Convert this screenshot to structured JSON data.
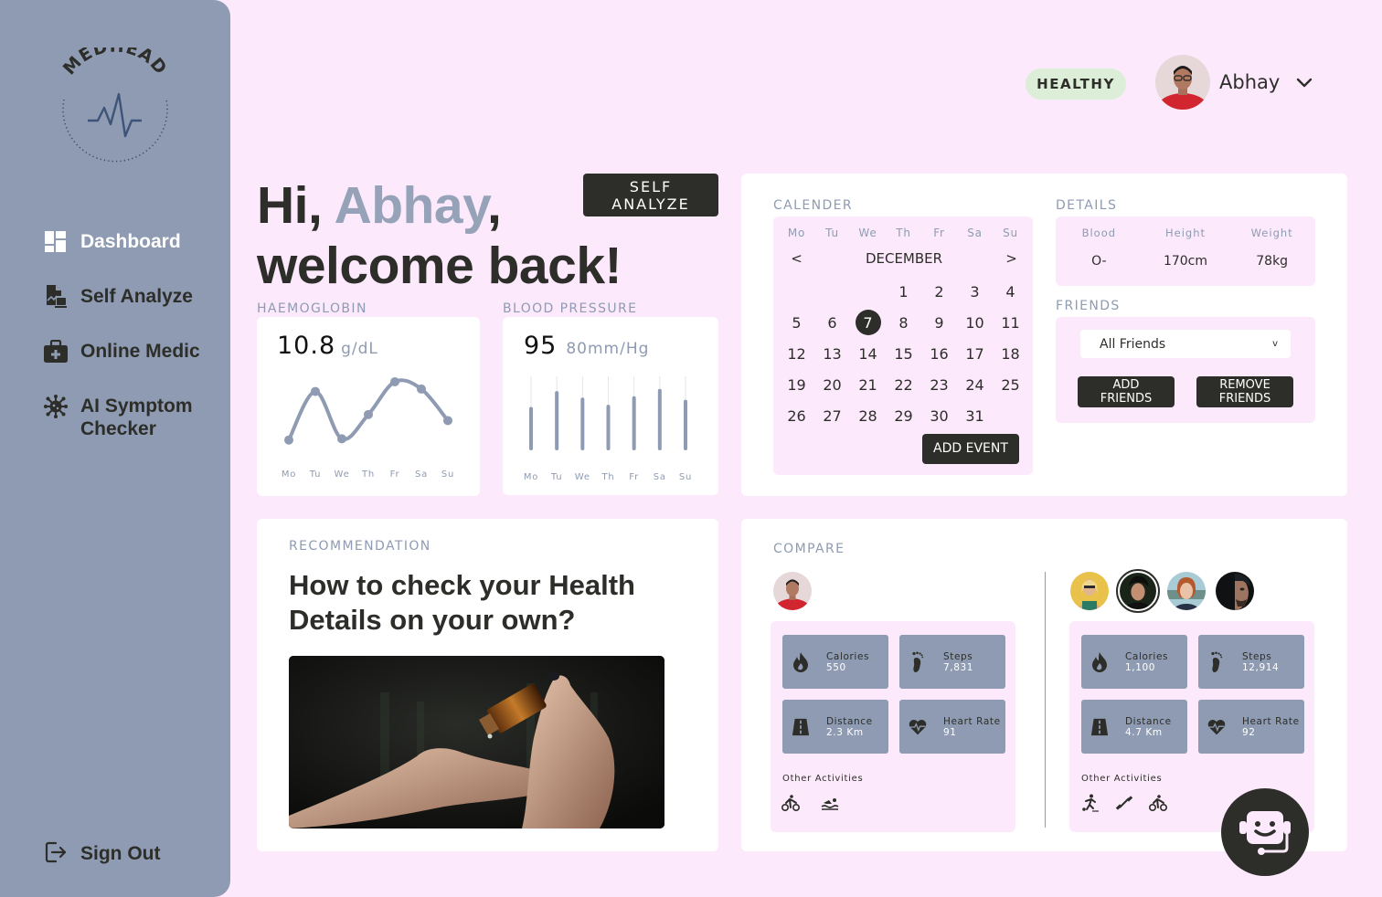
{
  "brand": {
    "name": "MEDHEAD"
  },
  "sidebar": {
    "items": [
      {
        "label": "Dashboard",
        "icon": "dashboard-icon",
        "active": true
      },
      {
        "label": "Self Analyze",
        "icon": "analysis-document-icon",
        "active": false
      },
      {
        "label": "Online Medic",
        "icon": "medical-kit-icon",
        "active": false
      },
      {
        "label": "AI Symptom Checker",
        "icon": "virus-icon",
        "active": false
      }
    ],
    "sign_out": {
      "label": "Sign Out",
      "icon": "sign-out-icon"
    }
  },
  "header": {
    "status": "HEALTHY",
    "user_name": "Abhay",
    "status_color": "#dcedd8"
  },
  "greeting": {
    "hi": "Hi, ",
    "name": "Abhay",
    "comma": ",",
    "line2": "welcome back!",
    "self_analyze_button": "SELF ANALYZE"
  },
  "haemoglobin": {
    "label": "HAEMOGLOBIN",
    "value": "10.8",
    "unit": "g/dL"
  },
  "blood_pressure": {
    "label": "BLOOD PRESSURE",
    "value": "95",
    "unit": "80mm/Hg"
  },
  "chart_data": [
    {
      "type": "line",
      "title": "HAEMOGLOBIN",
      "categories": [
        "Mo",
        "Tu",
        "We",
        "Th",
        "Fr",
        "Sa",
        "Su"
      ],
      "values": [
        10.0,
        12.0,
        10.05,
        11.05,
        12.4,
        12.1,
        10.8
      ],
      "ylim": [
        9.5,
        13
      ],
      "xlabel": "",
      "ylabel": "g/dL",
      "grid": false,
      "color": "#8e9bb2"
    },
    {
      "type": "bar",
      "title": "BLOOD PRESSURE",
      "categories": [
        "Mo",
        "Tu",
        "We",
        "Th",
        "Fr",
        "Sa",
        "Su"
      ],
      "values": [
        55,
        77,
        68,
        58,
        70,
        80,
        65
      ],
      "ylim": [
        0,
        100
      ],
      "xlabel": "",
      "ylabel": "mm/Hg",
      "grid": false,
      "color": "#8e9bb2"
    }
  ],
  "calendar": {
    "label": "CALENDER",
    "weekdays": [
      "Mo",
      "Tu",
      "We",
      "Th",
      "Fr",
      "Sa",
      "Su"
    ],
    "month": "DECEMBER",
    "prev": "<",
    "next": ">",
    "leading_blanks": 3,
    "days": 31,
    "selected_day": 7,
    "add_event_button": "ADD EVENT"
  },
  "details": {
    "label": "DETAILS",
    "fields": [
      {
        "key": "Blood",
        "value": "O-"
      },
      {
        "key": "Height",
        "value": "170cm"
      },
      {
        "key": "Weight",
        "value": "78kg"
      }
    ]
  },
  "friends": {
    "label": "FRIENDS",
    "select_value": "All Friends",
    "select_chevron": "v",
    "add_button": "ADD FRIENDS",
    "remove_button": "REMOVE FRIENDS"
  },
  "recommendation": {
    "label": "RECOMMENDATION",
    "title": "How to check your Health Details on your own?",
    "image_alt": "hands applying drops from an amber bottle"
  },
  "compare": {
    "label": "COMPARE",
    "left": {
      "stats": [
        {
          "key": "Calories",
          "value": "550",
          "icon": "flame-icon"
        },
        {
          "key": "Steps",
          "value": "7,831",
          "icon": "footprint-icon"
        },
        {
          "key": "Distance",
          "value": "2.3 Km",
          "icon": "road-icon"
        },
        {
          "key": "Heart Rate",
          "value": "91",
          "icon": "heart-rate-icon"
        }
      ],
      "other_label": "Other Activities",
      "activities": [
        "cycling-icon",
        "swimming-icon"
      ]
    },
    "right": {
      "friends_count": 4,
      "selected_friend_index": 1,
      "stats": [
        {
          "key": "Calories",
          "value": "1,100",
          "icon": "flame-icon"
        },
        {
          "key": "Steps",
          "value": "12,914",
          "icon": "footprint-icon"
        },
        {
          "key": "Distance",
          "value": "4.7 Km",
          "icon": "road-icon"
        },
        {
          "key": "Heart Rate",
          "value": "92",
          "icon": "heart-rate-icon"
        }
      ],
      "other_label": "Other Activities",
      "activities": [
        "football-icon",
        "dumbbell-icon",
        "cycling-icon"
      ]
    }
  },
  "colors": {
    "background": "#fce9fc",
    "sidebar": "#8e9bb2",
    "dark": "#2d2e29",
    "accent": "#95a2b8",
    "tile": "#8e9bb2"
  }
}
